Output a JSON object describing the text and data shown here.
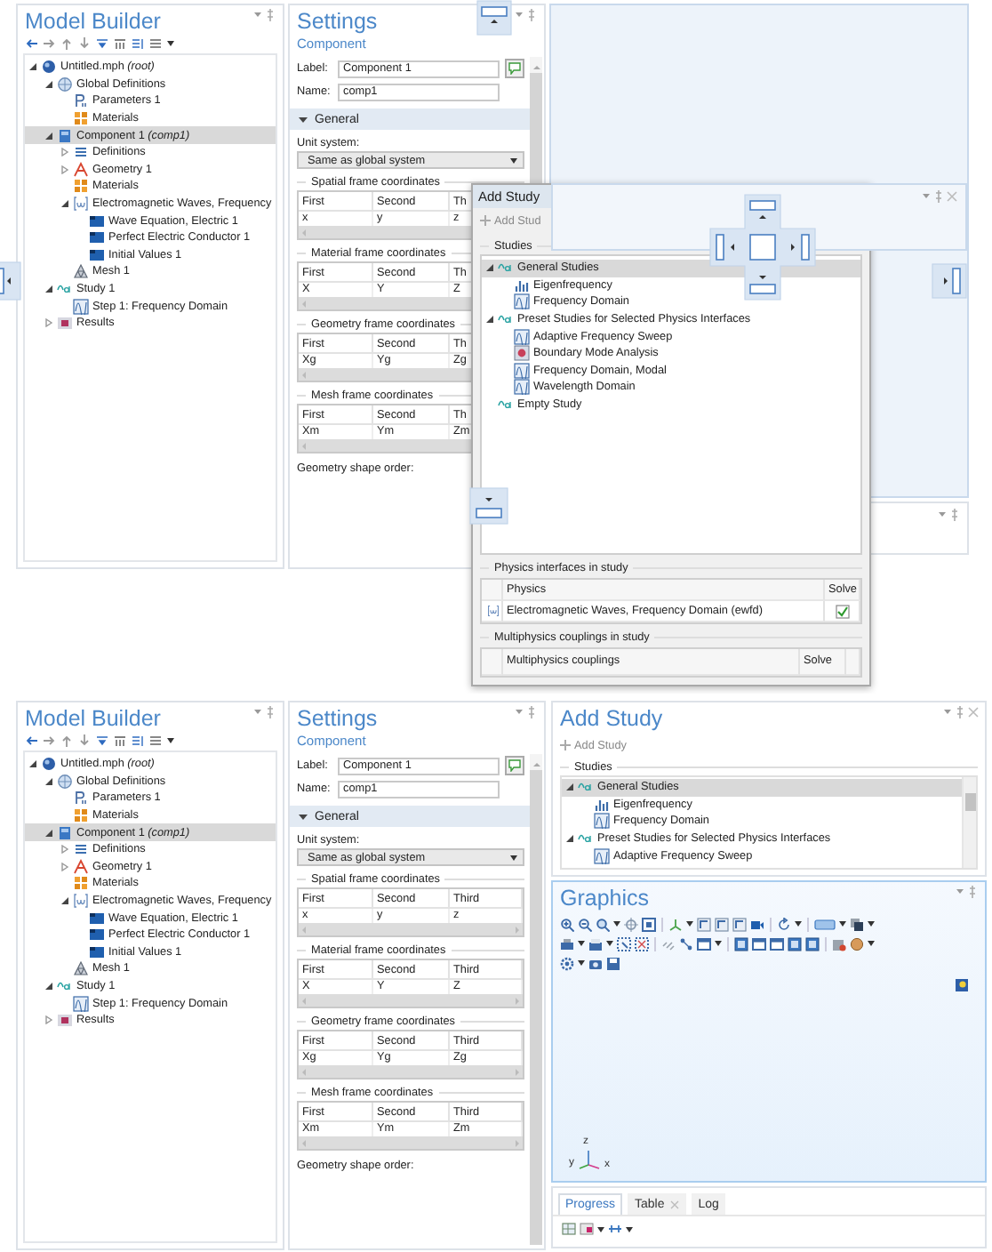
{
  "top_screen": {
    "model_builder": {
      "title": "Model Builder",
      "tree": [
        {
          "label": "Untitled.mph *(root)*",
          "kind": "root",
          "expanded": true,
          "selected": false,
          "children": [
            {
              "label": "Global Definitions",
              "kind": "globe",
              "expanded": true,
              "selected": false,
              "children": [
                {
                  "label": "Parameters 1",
                  "kind": "param",
                  "selected": false
                },
                {
                  "label": "Materials",
                  "kind": "material",
                  "selected": false
                }
              ]
            },
            {
              "label": "Component 1 *(comp1)*",
              "kind": "component",
              "expanded": true,
              "selected": true,
              "children": [
                {
                  "label": "Definitions",
                  "kind": "definitions",
                  "expanded": false,
                  "selected": false
                },
                {
                  "label": "Geometry 1",
                  "kind": "geometry",
                  "expanded": false,
                  "selected": false
                },
                {
                  "label": "Materials",
                  "kind": "material",
                  "selected": false
                },
                {
                  "label": "Electromagnetic Waves, Frequency",
                  "kind": "physics",
                  "expanded": true,
                  "selected": false,
                  "children": [
                    {
                      "label": "Wave Equation, Electric 1",
                      "kind": "feature",
                      "selected": false
                    },
                    {
                      "label": "Perfect Electric Conductor 1",
                      "kind": "feature",
                      "selected": false
                    },
                    {
                      "label": "Initial Values 1",
                      "kind": "feature",
                      "selected": false
                    }
                  ]
                },
                {
                  "label": "Mesh 1",
                  "kind": "mesh",
                  "selected": false
                }
              ]
            },
            {
              "label": "Study 1",
              "kind": "study",
              "expanded": true,
              "selected": false,
              "children": [
                {
                  "label": "Step 1: Frequency Domain",
                  "kind": "step",
                  "selected": false
                }
              ]
            },
            {
              "label": "Results",
              "kind": "results",
              "expanded": false,
              "selected": false
            }
          ]
        }
      ]
    },
    "settings": {
      "title": "Settings",
      "subtitle": "Component",
      "label_caption": "Label:",
      "label_value": "Component 1",
      "name_caption": "Name:",
      "name_value": "comp1",
      "section": {
        "title": "General",
        "expanded": true
      },
      "unit_caption": "Unit system:",
      "unit_value": "Same as global system",
      "frame_groups": [
        {
          "title": "Spatial frame coordinates",
          "columns": [
            "First",
            "Second",
            "Th"
          ],
          "values": [
            "x",
            "y",
            "z"
          ]
        },
        {
          "title": "Material frame coordinates",
          "columns": [
            "First",
            "Second",
            "Th"
          ],
          "values": [
            "X",
            "Y",
            "Z"
          ]
        },
        {
          "title": "Geometry frame coordinates",
          "columns": [
            "First",
            "Second",
            "Th"
          ],
          "values": [
            "Xg",
            "Yg",
            "Zg"
          ]
        },
        {
          "title": "Mesh frame coordinates",
          "columns": [
            "First",
            "Second",
            "Th"
          ],
          "values": [
            "Xm",
            "Ym",
            "Zm"
          ]
        }
      ],
      "footer": "Geometry shape order:"
    },
    "add_study_window": {
      "title": "Add Study",
      "add_button": "Add Stud",
      "studies_caption": "Studies",
      "tree": [
        {
          "label": "General Studies",
          "kind": "study",
          "expanded": true,
          "selected": true,
          "children": [
            {
              "label": "Eigenfrequency",
              "kind": "eigen",
              "selected": false
            },
            {
              "label": "Frequency Domain",
              "kind": "step",
              "selected": false
            }
          ]
        },
        {
          "label": "Preset Studies for Selected Physics Interfaces",
          "kind": "study",
          "expanded": true,
          "selected": false,
          "children": [
            {
              "label": "Adaptive Frequency Sweep",
              "kind": "step",
              "selected": false
            },
            {
              "label": "Boundary Mode Analysis",
              "kind": "boundary",
              "selected": false
            },
            {
              "label": "Frequency Domain, Modal",
              "kind": "step",
              "selected": false
            },
            {
              "label": "Wavelength Domain",
              "kind": "step",
              "selected": false
            }
          ]
        },
        {
          "label": "Empty Study",
          "kind": "study",
          "selected": false
        }
      ],
      "physics_caption": "Physics interfaces in study",
      "physics_columns": [
        "Physics",
        "Solve"
      ],
      "physics_rows": [
        {
          "name": "Electromagnetic Waves, Frequency Domain (ewfd)",
          "solve": true
        }
      ],
      "couplings_caption": "Multiphysics couplings in study",
      "couplings_columns": [
        "Multiphysics couplings",
        "Solve"
      ]
    }
  },
  "bottom_screen": {
    "model_builder": {
      "title": "Model Builder",
      "tree": [
        {
          "label": "Untitled.mph *(root)*",
          "kind": "root",
          "expanded": true,
          "selected": false,
          "children": [
            {
              "label": "Global Definitions",
              "kind": "globe",
              "expanded": true,
              "selected": false,
              "children": [
                {
                  "label": "Parameters 1",
                  "kind": "param",
                  "selected": false
                },
                {
                  "label": "Materials",
                  "kind": "material",
                  "selected": false
                }
              ]
            },
            {
              "label": "Component 1 *(comp1)*",
              "kind": "component",
              "expanded": true,
              "selected": true,
              "children": [
                {
                  "label": "Definitions",
                  "kind": "definitions",
                  "expanded": false,
                  "selected": false
                },
                {
                  "label": "Geometry 1",
                  "kind": "geometry",
                  "expanded": false,
                  "selected": false
                },
                {
                  "label": "Materials",
                  "kind": "material",
                  "selected": false
                },
                {
                  "label": "Electromagnetic Waves, Frequency",
                  "kind": "physics",
                  "expanded": true,
                  "selected": false,
                  "children": [
                    {
                      "label": "Wave Equation, Electric 1",
                      "kind": "feature",
                      "selected": false
                    },
                    {
                      "label": "Perfect Electric Conductor 1",
                      "kind": "feature",
                      "selected": false
                    },
                    {
                      "label": "Initial Values 1",
                      "kind": "feature",
                      "selected": false
                    }
                  ]
                },
                {
                  "label": "Mesh 1",
                  "kind": "mesh",
                  "selected": false
                }
              ]
            },
            {
              "label": "Study 1",
              "kind": "study",
              "expanded": true,
              "selected": false,
              "children": [
                {
                  "label": "Step 1: Frequency Domain",
                  "kind": "step",
                  "selected": false
                }
              ]
            },
            {
              "label": "Results",
              "kind": "results",
              "expanded": false,
              "selected": false
            }
          ]
        }
      ]
    },
    "settings": {
      "title": "Settings",
      "subtitle": "Component",
      "label_caption": "Label:",
      "label_value": "Component 1",
      "name_caption": "Name:",
      "name_value": "comp1",
      "section": {
        "title": "General",
        "expanded": true
      },
      "unit_caption": "Unit system:",
      "unit_value": "Same as global system",
      "frame_groups": [
        {
          "title": "Spatial frame coordinates",
          "columns": [
            "First",
            "Second",
            "Third"
          ],
          "values": [
            "x",
            "y",
            "z"
          ]
        },
        {
          "title": "Material frame coordinates",
          "columns": [
            "First",
            "Second",
            "Third"
          ],
          "values": [
            "X",
            "Y",
            "Z"
          ]
        },
        {
          "title": "Geometry frame coordinates",
          "columns": [
            "First",
            "Second",
            "Third"
          ],
          "values": [
            "Xg",
            "Yg",
            "Zg"
          ]
        },
        {
          "title": "Mesh frame coordinates",
          "columns": [
            "First",
            "Second",
            "Third"
          ],
          "values": [
            "Xm",
            "Ym",
            "Zm"
          ]
        }
      ],
      "footer": "Geometry shape order:"
    },
    "add_study": {
      "title": "Add Study",
      "add_button": "Add Study",
      "studies_caption": "Studies",
      "tree": [
        {
          "label": "General Studies",
          "kind": "study",
          "expanded": true,
          "selected": true,
          "children": [
            {
              "label": "Eigenfrequency",
              "kind": "eigen",
              "selected": false
            },
            {
              "label": "Frequency Domain",
              "kind": "step",
              "selected": false
            }
          ]
        },
        {
          "label": "Preset Studies for Selected Physics Interfaces",
          "kind": "study",
          "expanded": true,
          "selected": false,
          "children": [
            {
              "label": "Adaptive Frequency Sweep",
              "kind": "step",
              "selected": false
            }
          ]
        }
      ]
    },
    "graphics": {
      "title": "Graphics",
      "axis_labels": {
        "x": "x",
        "y": "y",
        "z": "z"
      }
    },
    "log_tabs": [
      {
        "label": "Progress",
        "selected": true,
        "closable": false
      },
      {
        "label": "Table",
        "selected": false,
        "closable": true
      },
      {
        "label": "Log",
        "selected": false,
        "closable": false
      }
    ]
  }
}
